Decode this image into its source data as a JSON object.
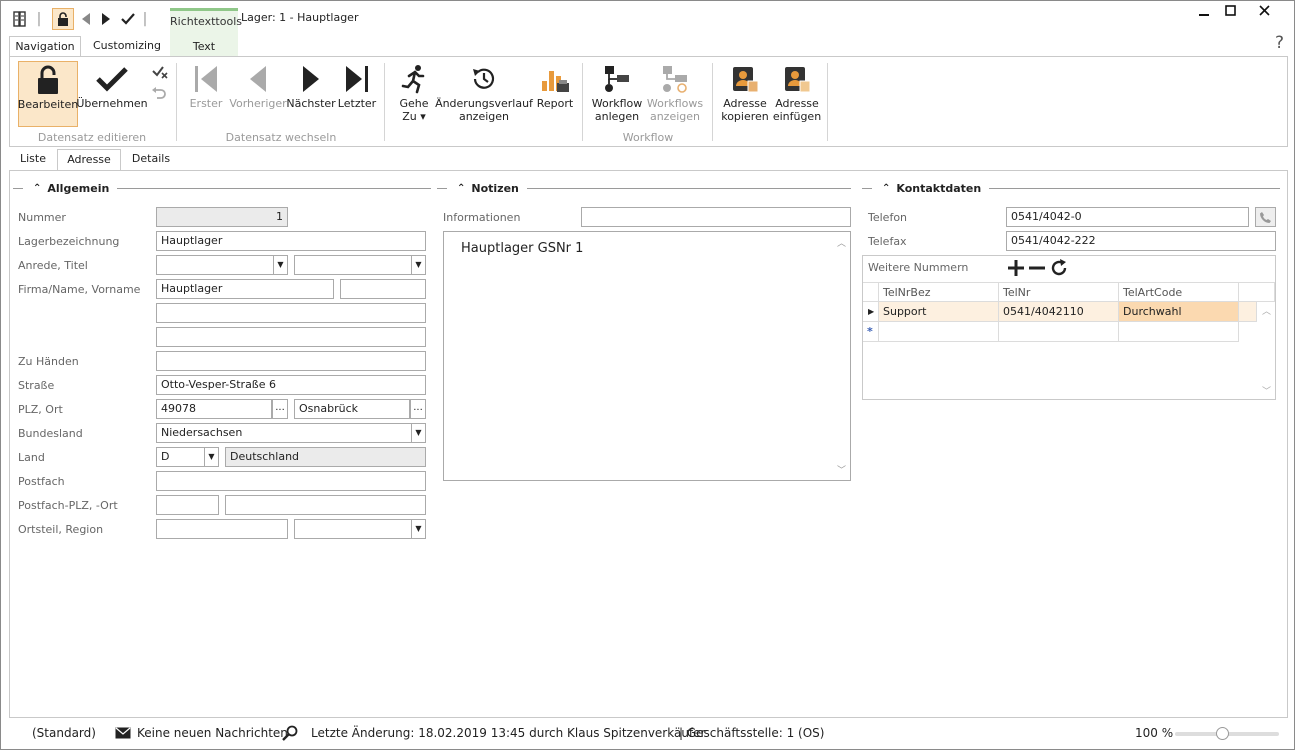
{
  "window": {
    "title": "Lager: 1 - Hauptlager",
    "help": "?"
  },
  "context_tab": {
    "group": "Richtexttools",
    "tab": "Text"
  },
  "ribbon_tabs": [
    {
      "label": "Navigation"
    },
    {
      "label": "Customizing"
    }
  ],
  "ribbon": {
    "groups": {
      "edit": "Datensatz editieren",
      "switch": "Datensatz wechseln",
      "workflow": "Workflow"
    },
    "buttons": {
      "bearbeiten": "Bearbeiten",
      "uebernehmen": "Übernehmen",
      "erster": "Erster",
      "vorheriger": "Vorheriger",
      "naechster": "Nächster",
      "letzter": "Letzter",
      "gehe_zu_1": "Gehe",
      "gehe_zu_2": "Zu ▾",
      "aenderung_1": "Änderungsverlauf",
      "aenderung_2": "anzeigen",
      "report": "Report",
      "wf_anlegen_1": "Workflow",
      "wf_anlegen_2": "anlegen",
      "wf_anzeigen_1": "Workflows",
      "wf_anzeigen_2": "anzeigen",
      "adr_kopieren_1": "Adresse",
      "adr_kopieren_2": "kopieren",
      "adr_einfuegen_1": "Adresse",
      "adr_einfuegen_2": "einfügen"
    }
  },
  "page_tabs": [
    {
      "label": "Liste"
    },
    {
      "label": "Adresse"
    },
    {
      "label": "Details"
    }
  ],
  "allgemein": {
    "title": "Allgemein",
    "labels": {
      "nummer": "Nummer",
      "lagerbezeichnung": "Lagerbezeichnung",
      "anrede": "Anrede, Titel",
      "firma": "Firma/Name, Vorname",
      "zu_haenden": "Zu Händen",
      "strasse": "Straße",
      "plz_ort": "PLZ, Ort",
      "bundesland": "Bundesland",
      "land": "Land",
      "postfach": "Postfach",
      "postfach_plz": "Postfach-PLZ, -Ort",
      "ortsteil": "Ortsteil, Region"
    },
    "values": {
      "nummer": "1",
      "lagerbezeichnung": "Hauptlager",
      "anrede": "",
      "titel": "",
      "firma": "Hauptlager",
      "vorname": "",
      "zeile2": "",
      "zeile3": "",
      "zu_haenden": "",
      "strasse": "Otto-Vesper-Straße 6",
      "plz": "49078",
      "ort": "Osnabrück",
      "bundesland": "Niedersachsen",
      "land_code": "D",
      "land_name": "Deutschland",
      "postfach": "",
      "postfach_plz": "",
      "postfach_ort": "",
      "ortsteil": "",
      "region": ""
    },
    "ellipsis": "..."
  },
  "notizen": {
    "title": "Notizen",
    "informationen_label": "Informationen",
    "informationen": "",
    "text": "Hauptlager GSNr 1"
  },
  "kontakt": {
    "title": "Kontaktdaten",
    "telefon_label": "Telefon",
    "telefon": "0541/4042-0",
    "telefax_label": "Telefax",
    "telefax": "0541/4042-222",
    "weitere": "Weitere Nummern",
    "columns": [
      "TelNrBez",
      "TelNr",
      "TelArtCode"
    ],
    "rows": [
      {
        "bez": "Support",
        "nr": "0541/4042110",
        "art": "Durchwahl"
      }
    ],
    "new_row_marker": "*"
  },
  "status": {
    "mode": "(Standard)",
    "messages": "Keine neuen Nachrichten",
    "last_change": "Letzte Änderung: 18.02.2019 13:45 durch Klaus Spitzenverkäufer",
    "branch": "| Geschäftsstelle:  1 (OS)",
    "zoom": "100 %",
    "zoom_value": 0.45
  },
  "colors": {
    "accent": "#8fc788",
    "selected": "#fbe7c9",
    "row_highlight": "#fdf0e0",
    "cell_highlight": "#fbd9b0"
  }
}
